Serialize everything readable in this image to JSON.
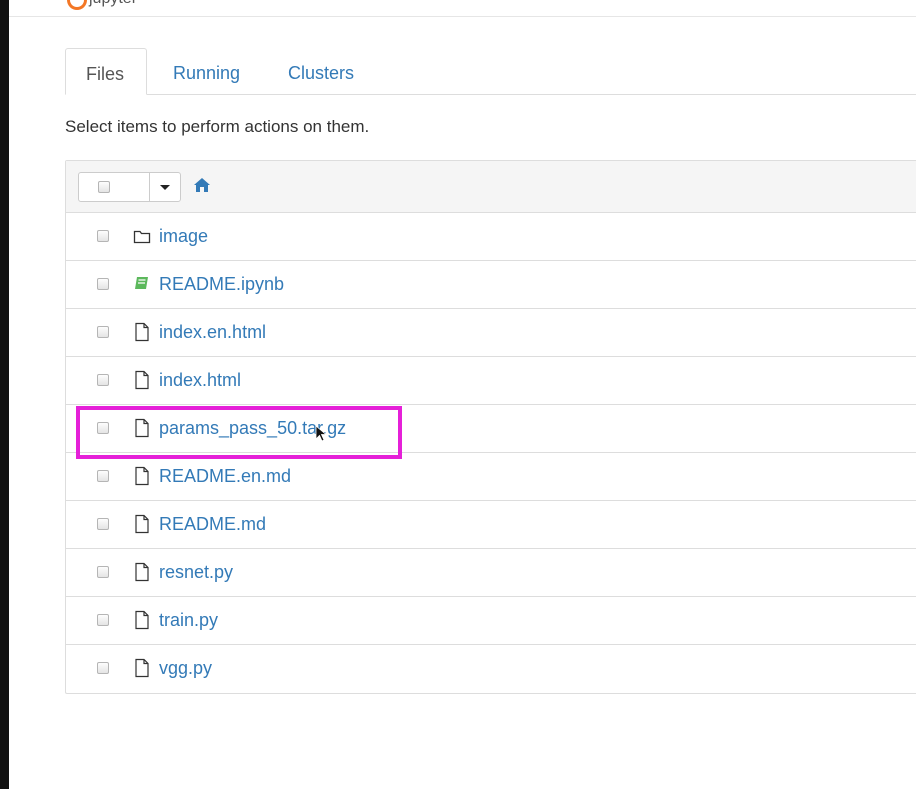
{
  "app": {
    "name": "jupyter"
  },
  "tabs": [
    {
      "label": "Files",
      "active": true
    },
    {
      "label": "Running",
      "active": false
    },
    {
      "label": "Clusters",
      "active": false
    }
  ],
  "instructions": "Select items to perform actions on them.",
  "toolbar": {
    "home_icon": "home-icon"
  },
  "files": [
    {
      "name": "image",
      "icon": "folder-icon"
    },
    {
      "name": "README.ipynb",
      "icon": "notebook-icon"
    },
    {
      "name": "index.en.html",
      "icon": "file-icon"
    },
    {
      "name": "index.html",
      "icon": "file-icon"
    },
    {
      "name": "params_pass_50.tar.gz",
      "icon": "file-icon",
      "highlighted": true
    },
    {
      "name": "README.en.md",
      "icon": "file-icon"
    },
    {
      "name": "README.md",
      "icon": "file-icon"
    },
    {
      "name": "resnet.py",
      "icon": "file-icon"
    },
    {
      "name": "train.py",
      "icon": "file-icon"
    },
    {
      "name": "vgg.py",
      "icon": "file-icon"
    }
  ],
  "colors": {
    "link": "#337ab7",
    "highlight": "#e520d8",
    "notebook": "#5cb85c",
    "accent": "#f37726"
  }
}
